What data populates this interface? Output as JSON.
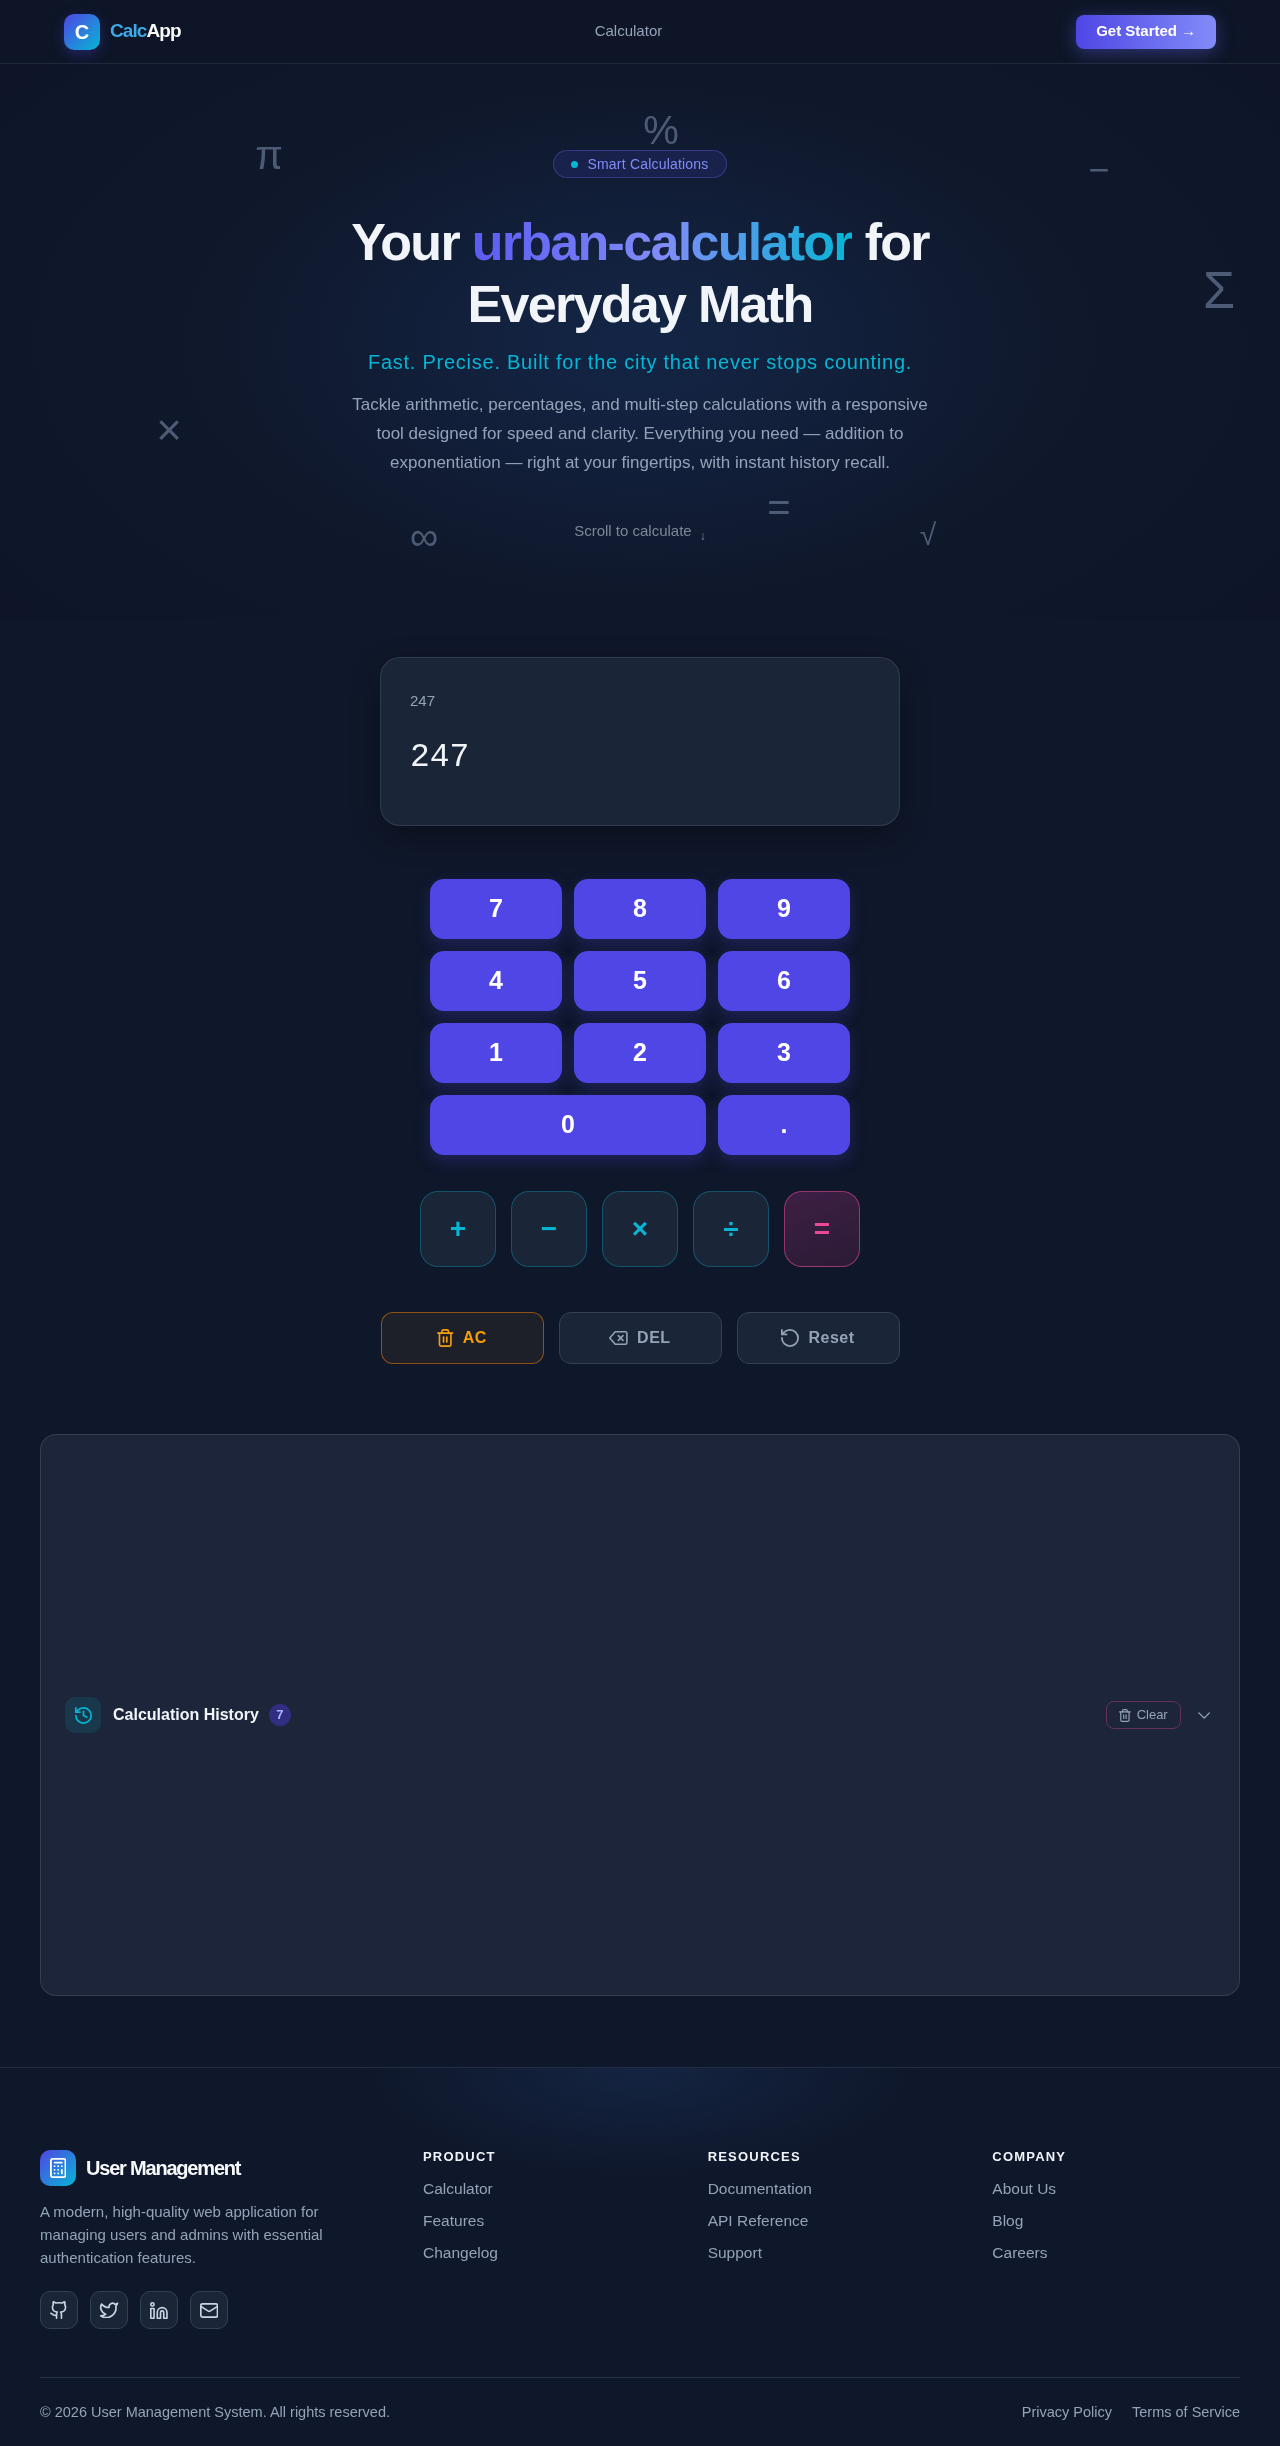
{
  "navbar": {
    "logo_letter": "C",
    "brand": [
      {
        "text": "Calc",
        "kind": "accent"
      },
      {
        "text": "App",
        "kind": "plain"
      }
    ],
    "links": [
      {
        "label": "Calculator"
      }
    ],
    "cta": {
      "label": "Get Started",
      "arrow": "→"
    }
  },
  "hero": {
    "symbols": [
      "π",
      "%",
      "−",
      "Σ",
      "×",
      "∞",
      "=",
      "√"
    ],
    "badge": "Smart Calculations",
    "title": [
      {
        "text": "Your ",
        "kind": "plain"
      },
      {
        "text": "urban-calculator",
        "kind": "gradient"
      },
      {
        "text": " for Everyday Math",
        "kind": "plain"
      }
    ],
    "subtitle": "Fast. Precise. Built for the city that never stops counting.",
    "description": "Tackle arithmetic, percentages, and multi-step calculations with a responsive tool designed for speed and clarity. Everything you need — addition to exponentiation — right at your fingertips, with instant history recall.",
    "scroll_hint": {
      "label": "Scroll to calculate",
      "arrow": "↓"
    }
  },
  "calculator": {
    "display": {
      "expression": "247",
      "value": "247"
    },
    "keys": [
      {
        "label": "7",
        "kind": "digit"
      },
      {
        "label": "8",
        "kind": "digit"
      },
      {
        "label": "9",
        "kind": "digit"
      },
      {
        "label": "4",
        "kind": "digit"
      },
      {
        "label": "5",
        "kind": "digit"
      },
      {
        "label": "6",
        "kind": "digit"
      },
      {
        "label": "1",
        "kind": "digit"
      },
      {
        "label": "2",
        "kind": "digit"
      },
      {
        "label": "3",
        "kind": "digit"
      },
      {
        "label": "0",
        "kind": "wide"
      },
      {
        "label": ".",
        "kind": "decimal"
      }
    ],
    "operators": [
      {
        "label": "+",
        "kind": "operator"
      },
      {
        "label": "−",
        "kind": "operator"
      },
      {
        "label": "×",
        "kind": "operator"
      },
      {
        "label": "÷",
        "kind": "operator"
      },
      {
        "label": "=",
        "kind": "equals"
      }
    ],
    "actions": [
      {
        "label": "AC",
        "kind": "clear"
      },
      {
        "label": "DEL",
        "kind": "delete"
      },
      {
        "label": "Reset",
        "kind": "reset"
      }
    ]
  },
  "history": {
    "title": "Calculation History",
    "count": "7",
    "clear_label": "Clear",
    "expanded": false
  },
  "footer": {
    "brand": "User Management",
    "description": "A modern, high-quality web application for managing users and admins with essential authentication features.",
    "socials": [
      {
        "kind": "github"
      },
      {
        "kind": "twitter"
      },
      {
        "kind": "linkedin"
      },
      {
        "kind": "mail"
      }
    ],
    "columns": [
      {
        "heading": "PRODUCT",
        "links": [
          "Calculator",
          "Features",
          "Changelog"
        ]
      },
      {
        "heading": "RESOURCES",
        "links": [
          "Documentation",
          "API Reference",
          "Support"
        ]
      },
      {
        "heading": "COMPANY",
        "links": [
          "About Us",
          "Blog",
          "Careers"
        ]
      }
    ],
    "copyright": "© 2026 User Management System. All rights reserved.",
    "legal_links": [
      "Privacy Policy",
      "Terms of Service"
    ]
  }
}
